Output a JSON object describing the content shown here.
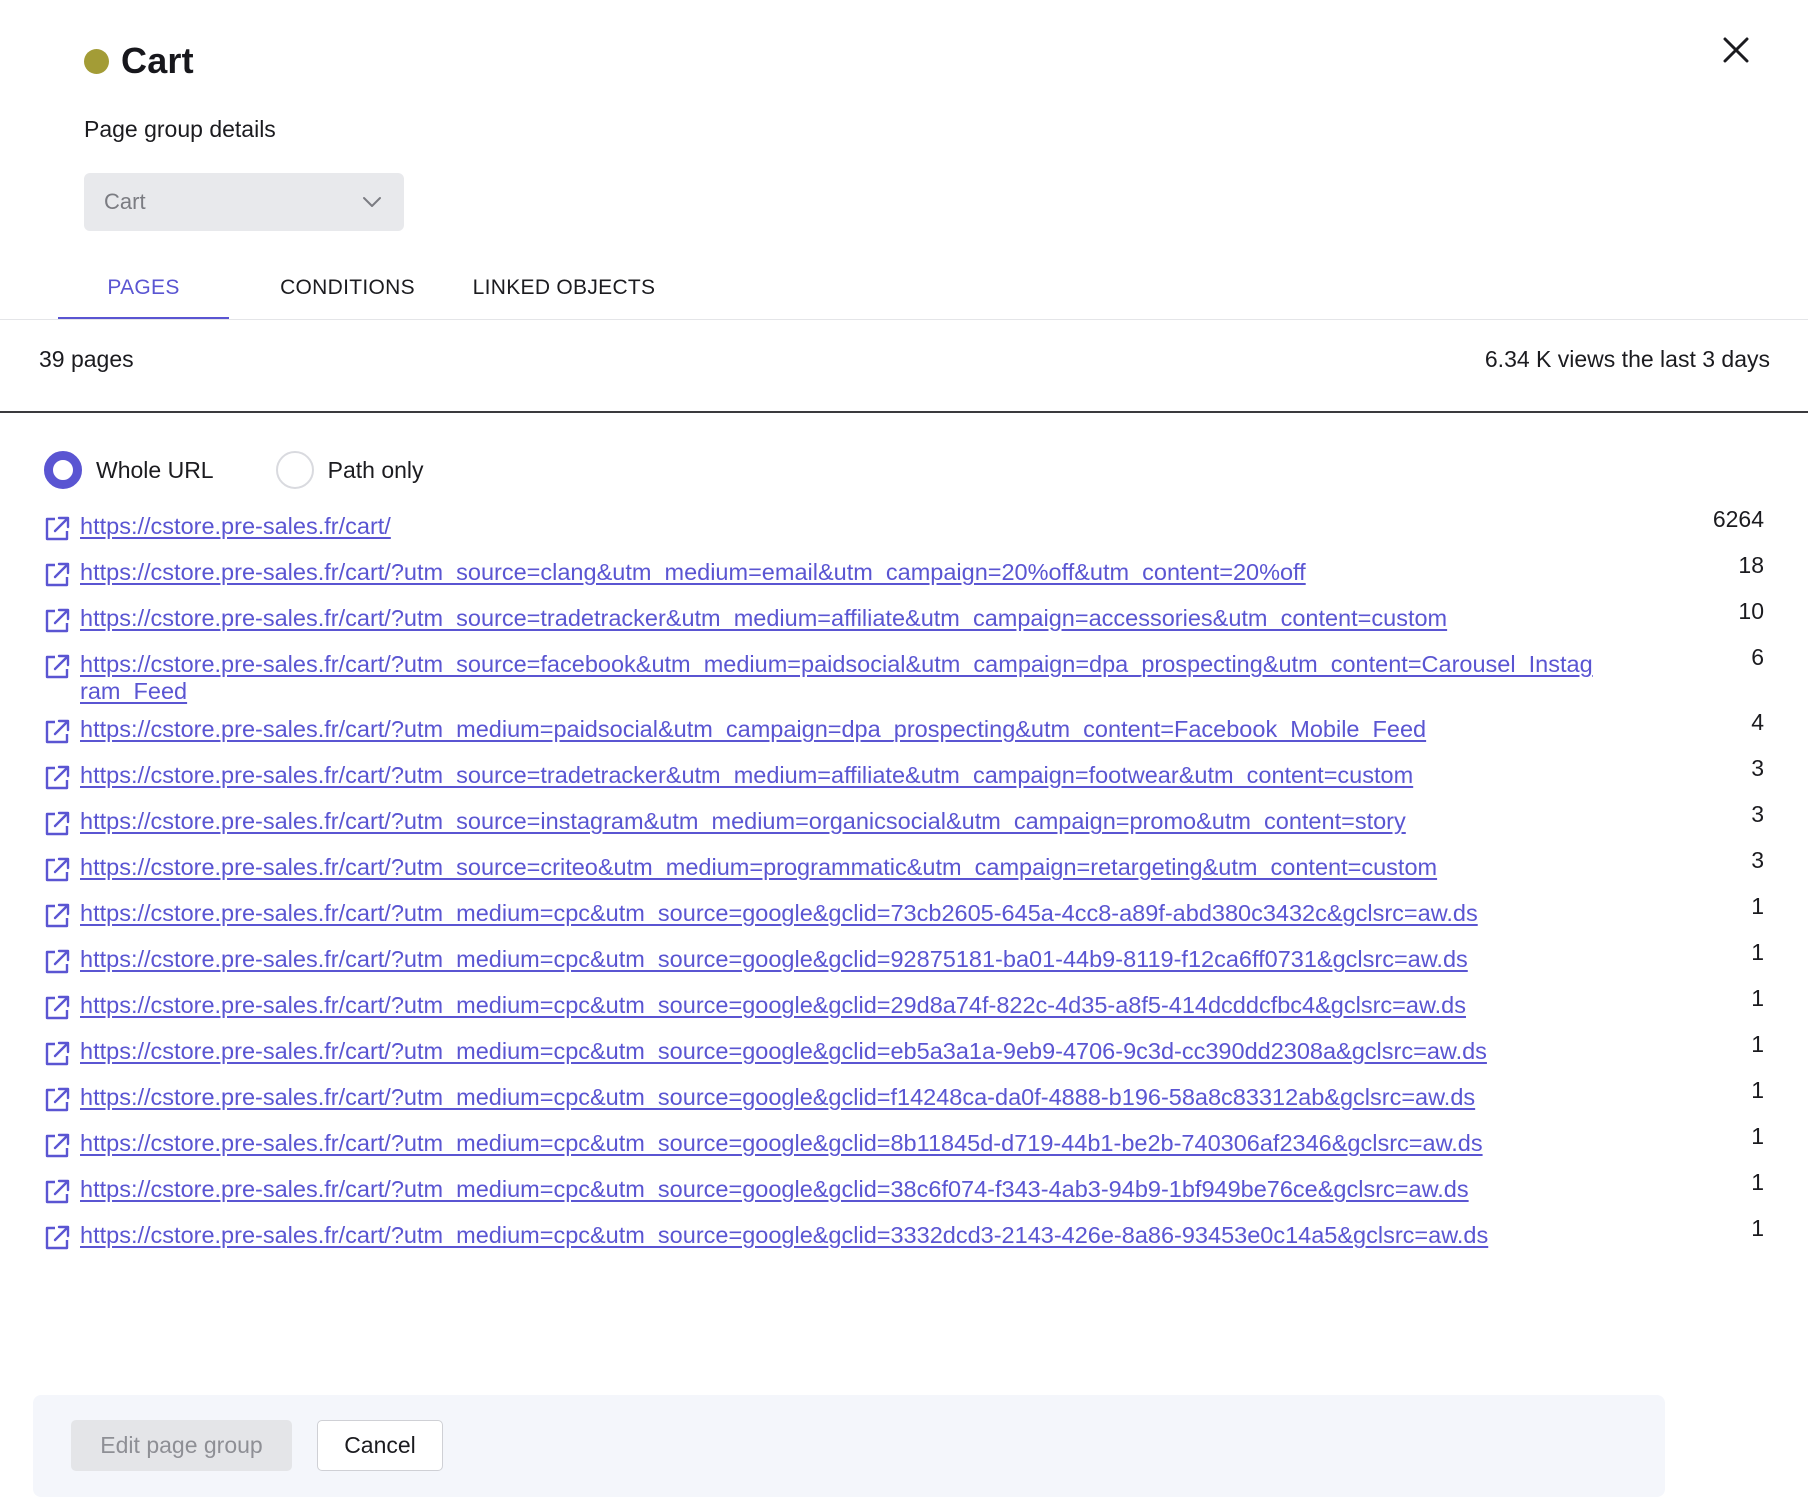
{
  "header": {
    "title": "Cart",
    "status_color": "#a39c36",
    "subtitle": "Page group details",
    "close_icon": "close-icon"
  },
  "page_group_select": {
    "value": "Cart"
  },
  "tabs": [
    {
      "label": "PAGES",
      "active": true
    },
    {
      "label": "CONDITIONS",
      "active": false
    },
    {
      "label": "LINKED OBJECTS",
      "active": false
    }
  ],
  "summary": {
    "page_count": "39 pages",
    "views": "6.34 K views the last 3 days"
  },
  "url_mode": {
    "options": [
      {
        "label": "Whole URL",
        "checked": true
      },
      {
        "label": "Path only",
        "checked": false
      }
    ]
  },
  "pages": [
    {
      "url": "https://cstore.pre-sales.fr/cart/",
      "count": "6264"
    },
    {
      "url": "https://cstore.pre-sales.fr/cart/?utm_source=clang&utm_medium=email&utm_campaign=20%off&utm_content=20%off",
      "count": "18"
    },
    {
      "url": "https://cstore.pre-sales.fr/cart/?utm_source=tradetracker&utm_medium=affiliate&utm_campaign=accessories&utm_content=custom",
      "count": "10"
    },
    {
      "url": "https://cstore.pre-sales.fr/cart/?utm_source=facebook&utm_medium=paidsocial&utm_campaign=dpa_prospecting&utm_content=Carousel_Instagram_Feed",
      "count": "6"
    },
    {
      "url": "https://cstore.pre-sales.fr/cart/?utm_medium=paidsocial&utm_campaign=dpa_prospecting&utm_content=Facebook_Mobile_Feed",
      "count": "4"
    },
    {
      "url": "https://cstore.pre-sales.fr/cart/?utm_source=tradetracker&utm_medium=affiliate&utm_campaign=footwear&utm_content=custom",
      "count": "3"
    },
    {
      "url": "https://cstore.pre-sales.fr/cart/?utm_source=instagram&utm_medium=organicsocial&utm_campaign=promo&utm_content=story",
      "count": "3"
    },
    {
      "url": "https://cstore.pre-sales.fr/cart/?utm_source=criteo&utm_medium=programmatic&utm_campaign=retargeting&utm_content=custom",
      "count": "3"
    },
    {
      "url": "https://cstore.pre-sales.fr/cart/?utm_medium=cpc&utm_source=google&gclid=73cb2605-645a-4cc8-a89f-abd380c3432c&gclsrc=aw.ds",
      "count": "1"
    },
    {
      "url": "https://cstore.pre-sales.fr/cart/?utm_medium=cpc&utm_source=google&gclid=92875181-ba01-44b9-8119-f12ca6ff0731&gclsrc=aw.ds",
      "count": "1"
    },
    {
      "url": "https://cstore.pre-sales.fr/cart/?utm_medium=cpc&utm_source=google&gclid=29d8a74f-822c-4d35-a8f5-414dcddcfbc4&gclsrc=aw.ds",
      "count": "1"
    },
    {
      "url": "https://cstore.pre-sales.fr/cart/?utm_medium=cpc&utm_source=google&gclid=eb5a3a1a-9eb9-4706-9c3d-cc390dd2308a&gclsrc=aw.ds",
      "count": "1"
    },
    {
      "url": "https://cstore.pre-sales.fr/cart/?utm_medium=cpc&utm_source=google&gclid=f14248ca-da0f-4888-b196-58a8c83312ab&gclsrc=aw.ds",
      "count": "1"
    },
    {
      "url": "https://cstore.pre-sales.fr/cart/?utm_medium=cpc&utm_source=google&gclid=8b11845d-d719-44b1-be2b-740306af2346&gclsrc=aw.ds",
      "count": "1"
    },
    {
      "url": "https://cstore.pre-sales.fr/cart/?utm_medium=cpc&utm_source=google&gclid=38c6f074-f343-4ab3-94b9-1bf949be76ce&gclsrc=aw.ds",
      "count": "1"
    },
    {
      "url": "https://cstore.pre-sales.fr/cart/?utm_medium=cpc&utm_source=google&gclid=3332dcd3-2143-426e-8a86-93453e0c14a5&gclsrc=aw.ds",
      "count": "1"
    }
  ],
  "footer": {
    "edit_label": "Edit page group",
    "cancel_label": "Cancel"
  },
  "colors": {
    "accent": "#5a55d2",
    "status_dot": "#a39c36"
  }
}
